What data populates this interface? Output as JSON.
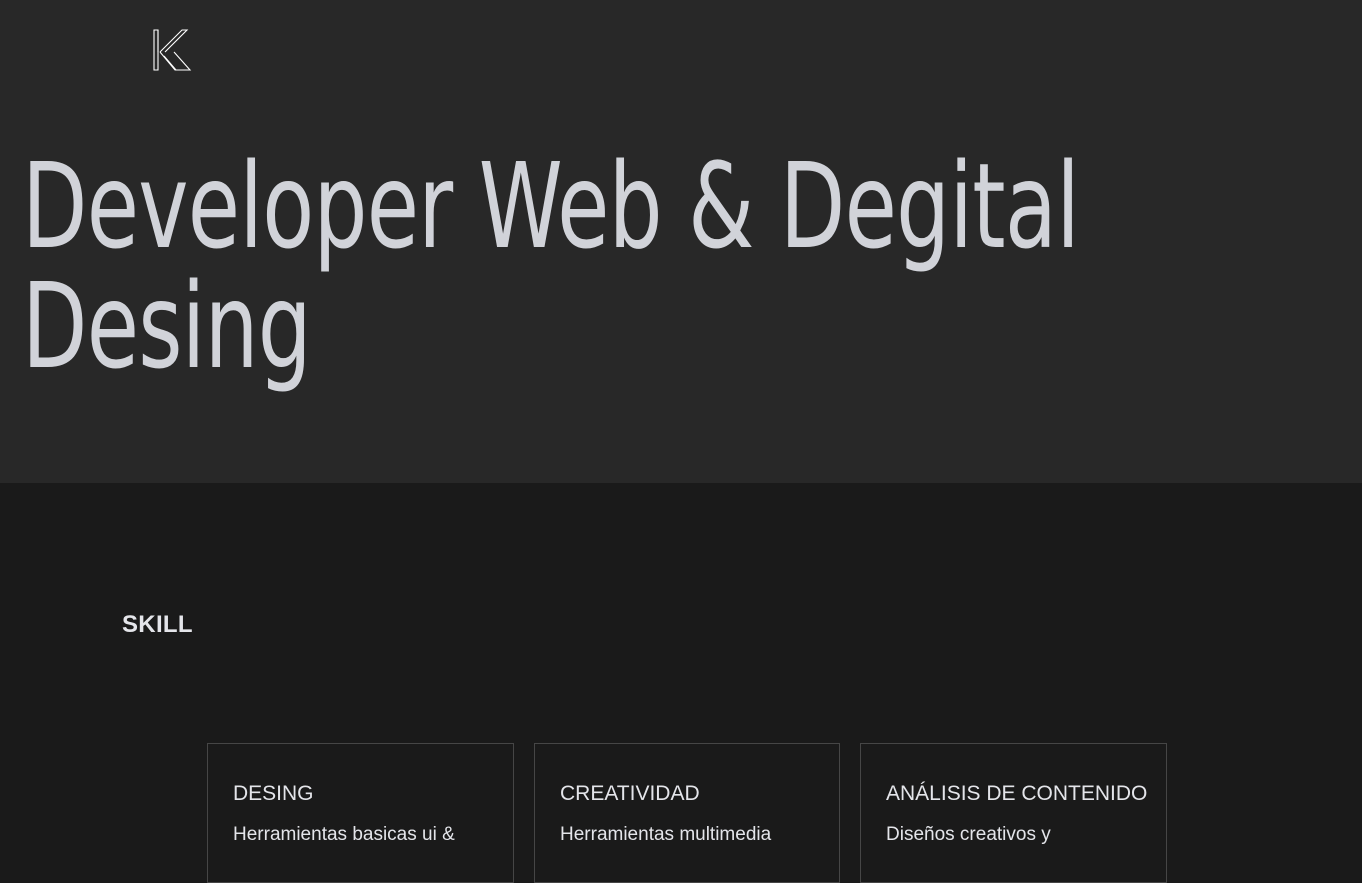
{
  "header": {
    "logo_icon": "k-monogram-logo-icon"
  },
  "hero": {
    "title_line_1": "Developer Web & Degital",
    "title_line_2": "Desing"
  },
  "skills": {
    "heading": "SKILL",
    "cards": [
      {
        "title": "DESING",
        "text": "Herramientas basicas ui &"
      },
      {
        "title": "CREATIVIDAD",
        "text": "Herramientas multimedia"
      },
      {
        "title": "ANÁLISIS DE CONTENIDO",
        "text": "Diseños creativos y"
      }
    ]
  },
  "colors": {
    "hero_bg": "#282828",
    "page_bg": "#1a1a1a",
    "title_text": "#d1d3d9",
    "body_text": "#e4e5ea",
    "card_border": "#464646"
  }
}
